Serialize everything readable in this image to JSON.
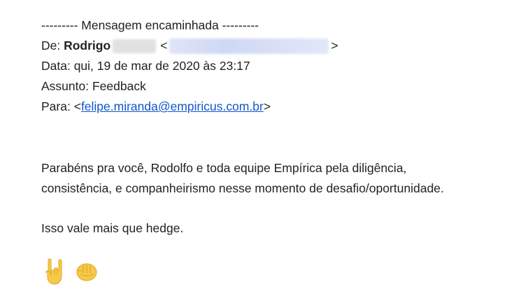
{
  "forward": {
    "header": "--------- Mensagem encaminhada ---------",
    "from_label": "De:",
    "from_name": "Rodrigo",
    "from_email_open": "<",
    "from_email_close": ">",
    "date_label": "Data:",
    "date_value": "qui, 19 de mar de 2020 às 23:17",
    "subject_label": "Assunto:",
    "subject_value": "Feedback",
    "to_label": "Para:",
    "to_open": "<",
    "to_email": "felipe.miranda@empiricus.com.br",
    "to_close": ">"
  },
  "body": {
    "paragraph1_line1": "Parabéns pra você, Rodolfo e toda equipe Empírica pela diligência,",
    "paragraph1_line2": "consistência, e companheirismo nesse momento de desafio/oportunidade.",
    "paragraph2": "Isso vale mais que hedge."
  },
  "emojis": [
    "rock-on-hand-icon",
    "fist-bump-icon"
  ],
  "colors": {
    "text": "#222222",
    "link": "#1155cc",
    "emoji_skin": "#F7C948"
  }
}
